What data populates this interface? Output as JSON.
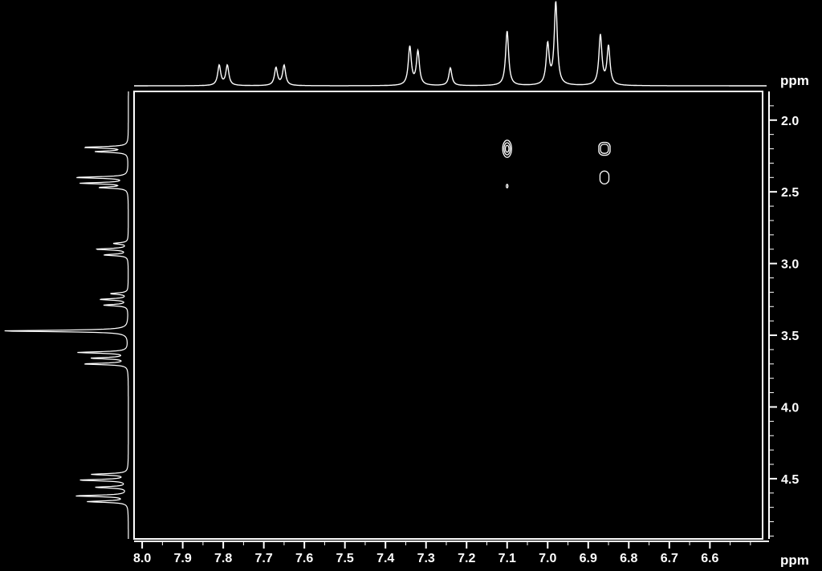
{
  "chart_data": {
    "type": "heatmap",
    "subtype": "2d-nmr-contour",
    "colors": {
      "background": "#000000",
      "foreground": "#ffffff"
    },
    "x_axis": {
      "label": "ppm",
      "reversed": true,
      "range": [
        8.02,
        6.47
      ],
      "ticks": [
        "8.0",
        "7.9",
        "7.8",
        "7.7",
        "7.6",
        "7.5",
        "7.4",
        "7.3",
        "7.2",
        "7.1",
        "7.0",
        "6.9",
        "6.8",
        "6.7",
        "6.6"
      ]
    },
    "y_axis": {
      "label": "ppm",
      "position": "right",
      "range": [
        1.8,
        4.92
      ],
      "ticks": [
        "2.0",
        "2.5",
        "3.0",
        "3.5",
        "4.0",
        "4.5"
      ]
    },
    "top_projection": {
      "peaks": [
        {
          "x": 7.81,
          "h": 25
        },
        {
          "x": 7.79,
          "h": 25
        },
        {
          "x": 7.67,
          "h": 22
        },
        {
          "x": 7.65,
          "h": 25
        },
        {
          "x": 7.34,
          "h": 48
        },
        {
          "x": 7.32,
          "h": 42
        },
        {
          "x": 7.24,
          "h": 22
        },
        {
          "x": 7.1,
          "h": 68
        },
        {
          "x": 7.0,
          "h": 50
        },
        {
          "x": 6.98,
          "h": 103
        },
        {
          "x": 6.87,
          "h": 62
        },
        {
          "x": 6.85,
          "h": 48
        }
      ]
    },
    "left_projection": {
      "peaks": [
        {
          "y": 2.19,
          "h": 55
        },
        {
          "y": 2.22,
          "h": 40
        },
        {
          "y": 2.4,
          "h": 65
        },
        {
          "y": 2.44,
          "h": 58
        },
        {
          "y": 2.47,
          "h": 35
        },
        {
          "y": 2.86,
          "h": 18
        },
        {
          "y": 2.9,
          "h": 40
        },
        {
          "y": 2.94,
          "h": 30
        },
        {
          "y": 3.21,
          "h": 22
        },
        {
          "y": 3.25,
          "h": 35
        },
        {
          "y": 3.29,
          "h": 30
        },
        {
          "y": 3.47,
          "h": 158
        },
        {
          "y": 3.62,
          "h": 62
        },
        {
          "y": 3.66,
          "h": 45
        },
        {
          "y": 3.7,
          "h": 55
        },
        {
          "y": 4.47,
          "h": 45
        },
        {
          "y": 4.51,
          "h": 60
        },
        {
          "y": 4.56,
          "h": 40
        },
        {
          "y": 4.62,
          "h": 65
        },
        {
          "y": 4.66,
          "h": 50
        }
      ]
    },
    "cross_peaks": [
      {
        "x": 7.1,
        "y": 2.2,
        "rx": 0.011,
        "ry": 0.06,
        "levels": 3
      },
      {
        "x": 7.1,
        "y": 2.46,
        "rx": 0.002,
        "ry": 0.012,
        "levels": 1
      },
      {
        "x": 6.86,
        "y": 2.2,
        "rx": 0.014,
        "ry": 0.045,
        "levels": 2
      },
      {
        "x": 6.86,
        "y": 2.4,
        "rx": 0.011,
        "ry": 0.045,
        "levels": 1
      }
    ]
  }
}
